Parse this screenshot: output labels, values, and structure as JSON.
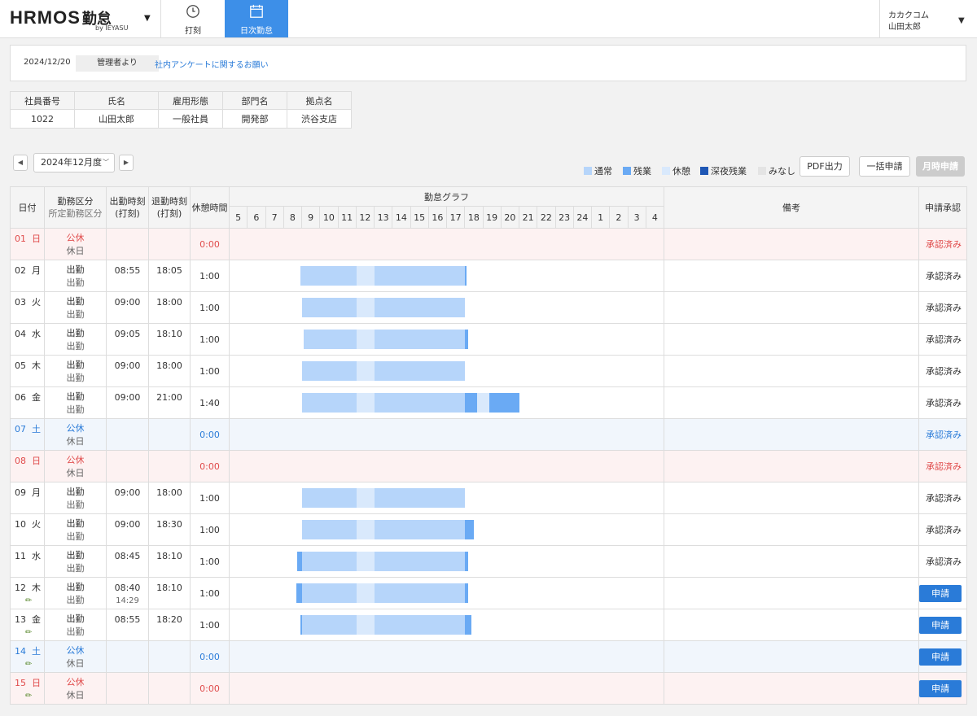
{
  "header": {
    "logo": "HRMOS",
    "logo_kin": "勤怠",
    "logo_sub": "by IEYASU",
    "tabs": [
      {
        "label": "打刻",
        "icon": "clock-icon"
      },
      {
        "label": "日次勤怠",
        "icon": "calendar-icon",
        "active": true
      }
    ],
    "user": {
      "company": "カカクコム",
      "name": "山田太郎"
    }
  },
  "notice": {
    "date": "2024/12/20",
    "from": "管理者より",
    "link": "社内アンケートに関するお願い"
  },
  "employee": {
    "headers": [
      "社員番号",
      "氏名",
      "雇用形態",
      "部門名",
      "拠点名"
    ],
    "values": [
      "1022",
      "山田太郎",
      "一般社員",
      "開発部",
      "渋谷支店"
    ]
  },
  "month": {
    "label": "2024年12月度"
  },
  "legend": [
    {
      "label": "通常",
      "color": "#b6d5fa"
    },
    {
      "label": "残業",
      "color": "#6aaaf4"
    },
    {
      "label": "休憩",
      "color": "#d9e9fc"
    },
    {
      "label": "深夜残業",
      "color": "#1f57b5"
    },
    {
      "label": "みなし",
      "color": "#e4e4e4"
    }
  ],
  "buttons": {
    "pdf": "PDF出力",
    "bulk": "一括申請",
    "monthly": "月時申請"
  },
  "table": {
    "headers": {
      "date": "日付",
      "kubun_main": "勤務区分",
      "kubun_sub": "所定勤務区分",
      "start": "出勤時刻",
      "start_sub": "(打刻)",
      "end": "退勤時刻",
      "end_sub": "(打刻)",
      "break": "休憩時間",
      "graph": "勤怠グラフ",
      "note": "備考",
      "approval": "申請承認"
    },
    "hours": [
      "5",
      "6",
      "7",
      "8",
      "9",
      "10",
      "11",
      "12",
      "13",
      "14",
      "15",
      "16",
      "17",
      "18",
      "19",
      "20",
      "21",
      "22",
      "23",
      "24",
      "1",
      "2",
      "3",
      "4"
    ],
    "rows": [
      {
        "day": "01",
        "wd": "日",
        "type": "sun",
        "kubun": "公休",
        "sub": "休日",
        "start": "",
        "end": "",
        "start2": "",
        "break": "0:00",
        "approval": "承認済み",
        "btn": false,
        "pen": false,
        "segs": []
      },
      {
        "day": "02",
        "wd": "月",
        "type": "",
        "kubun": "出勤",
        "sub": "出勤",
        "start": "08:55",
        "end": "18:05",
        "start2": "",
        "break": "1:00",
        "approval": "承認済み",
        "btn": false,
        "pen": false,
        "segs": [
          {
            "f": 8.917,
            "t": 12,
            "k": "n"
          },
          {
            "f": 12,
            "t": 13,
            "k": "b"
          },
          {
            "f": 13,
            "t": 18,
            "k": "n"
          },
          {
            "f": 18,
            "t": 18.083,
            "k": "o"
          }
        ]
      },
      {
        "day": "03",
        "wd": "火",
        "type": "",
        "kubun": "出勤",
        "sub": "出勤",
        "start": "09:00",
        "end": "18:00",
        "start2": "",
        "break": "1:00",
        "approval": "承認済み",
        "btn": false,
        "pen": false,
        "segs": [
          {
            "f": 9,
            "t": 12,
            "k": "n"
          },
          {
            "f": 12,
            "t": 13,
            "k": "b"
          },
          {
            "f": 13,
            "t": 18,
            "k": "n"
          }
        ]
      },
      {
        "day": "04",
        "wd": "水",
        "type": "",
        "kubun": "出勤",
        "sub": "出勤",
        "start": "09:05",
        "end": "18:10",
        "start2": "",
        "break": "1:00",
        "approval": "承認済み",
        "btn": false,
        "pen": false,
        "segs": [
          {
            "f": 9.083,
            "t": 12,
            "k": "n"
          },
          {
            "f": 12,
            "t": 13,
            "k": "b"
          },
          {
            "f": 13,
            "t": 18,
            "k": "n"
          },
          {
            "f": 18,
            "t": 18.167,
            "k": "o"
          }
        ]
      },
      {
        "day": "05",
        "wd": "木",
        "type": "",
        "kubun": "出勤",
        "sub": "出勤",
        "start": "09:00",
        "end": "18:00",
        "start2": "",
        "break": "1:00",
        "approval": "承認済み",
        "btn": false,
        "pen": false,
        "segs": [
          {
            "f": 9,
            "t": 12,
            "k": "n"
          },
          {
            "f": 12,
            "t": 13,
            "k": "b"
          },
          {
            "f": 13,
            "t": 18,
            "k": "n"
          }
        ]
      },
      {
        "day": "06",
        "wd": "金",
        "type": "",
        "kubun": "出勤",
        "sub": "出勤",
        "start": "09:00",
        "end": "21:00",
        "start2": "",
        "break": "1:40",
        "approval": "承認済み",
        "btn": false,
        "pen": false,
        "segs": [
          {
            "f": 9,
            "t": 12,
            "k": "n"
          },
          {
            "f": 12,
            "t": 13,
            "k": "b"
          },
          {
            "f": 13,
            "t": 18,
            "k": "n"
          },
          {
            "f": 18,
            "t": 18.667,
            "k": "o"
          },
          {
            "f": 18.667,
            "t": 19.333,
            "k": "b"
          },
          {
            "f": 19.333,
            "t": 21,
            "k": "o"
          }
        ]
      },
      {
        "day": "07",
        "wd": "土",
        "type": "sat",
        "kubun": "公休",
        "sub": "休日",
        "start": "",
        "end": "",
        "start2": "",
        "break": "0:00",
        "approval": "承認済み",
        "btn": false,
        "pen": false,
        "segs": []
      },
      {
        "day": "08",
        "wd": "日",
        "type": "sun",
        "kubun": "公休",
        "sub": "休日",
        "start": "",
        "end": "",
        "start2": "",
        "break": "0:00",
        "approval": "承認済み",
        "btn": false,
        "pen": false,
        "segs": []
      },
      {
        "day": "09",
        "wd": "月",
        "type": "",
        "kubun": "出勤",
        "sub": "出勤",
        "start": "09:00",
        "end": "18:00",
        "start2": "",
        "break": "1:00",
        "approval": "承認済み",
        "btn": false,
        "pen": false,
        "segs": [
          {
            "f": 9,
            "t": 12,
            "k": "n"
          },
          {
            "f": 12,
            "t": 13,
            "k": "b"
          },
          {
            "f": 13,
            "t": 18,
            "k": "n"
          }
        ]
      },
      {
        "day": "10",
        "wd": "火",
        "type": "",
        "kubun": "出勤",
        "sub": "出勤",
        "start": "09:00",
        "end": "18:30",
        "start2": "",
        "break": "1:00",
        "approval": "承認済み",
        "btn": false,
        "pen": false,
        "segs": [
          {
            "f": 9,
            "t": 12,
            "k": "n"
          },
          {
            "f": 12,
            "t": 13,
            "k": "b"
          },
          {
            "f": 13,
            "t": 18,
            "k": "n"
          },
          {
            "f": 18,
            "t": 18.5,
            "k": "o"
          }
        ]
      },
      {
        "day": "11",
        "wd": "水",
        "type": "",
        "kubun": "出勤",
        "sub": "出勤",
        "start": "08:45",
        "end": "18:10",
        "start2": "",
        "break": "1:00",
        "approval": "承認済み",
        "btn": false,
        "pen": false,
        "segs": [
          {
            "f": 8.75,
            "t": 9,
            "k": "o"
          },
          {
            "f": 9,
            "t": 12,
            "k": "n"
          },
          {
            "f": 12,
            "t": 13,
            "k": "b"
          },
          {
            "f": 13,
            "t": 18,
            "k": "n"
          },
          {
            "f": 18,
            "t": 18.167,
            "k": "o"
          }
        ]
      },
      {
        "day": "12",
        "wd": "木",
        "type": "",
        "kubun": "出勤",
        "sub": "出勤",
        "start": "08:40",
        "end": "18:10",
        "start2": "14:29",
        "break": "1:00",
        "approval": "申請",
        "btn": true,
        "pen": true,
        "segs": [
          {
            "f": 8.667,
            "t": 9,
            "k": "o"
          },
          {
            "f": 9,
            "t": 12,
            "k": "n"
          },
          {
            "f": 12,
            "t": 13,
            "k": "b"
          },
          {
            "f": 13,
            "t": 18,
            "k": "n"
          },
          {
            "f": 18,
            "t": 18.167,
            "k": "o"
          }
        ]
      },
      {
        "day": "13",
        "wd": "金",
        "type": "",
        "kubun": "出勤",
        "sub": "出勤",
        "start": "08:55",
        "end": "18:20",
        "start2": "",
        "break": "1:00",
        "approval": "申請",
        "btn": true,
        "pen": true,
        "segs": [
          {
            "f": 8.917,
            "t": 9,
            "k": "o"
          },
          {
            "f": 9,
            "t": 12,
            "k": "n"
          },
          {
            "f": 12,
            "t": 13,
            "k": "b"
          },
          {
            "f": 13,
            "t": 18,
            "k": "n"
          },
          {
            "f": 18,
            "t": 18.333,
            "k": "o"
          }
        ]
      },
      {
        "day": "14",
        "wd": "土",
        "type": "sat",
        "kubun": "公休",
        "sub": "休日",
        "start": "",
        "end": "",
        "start2": "",
        "break": "0:00",
        "approval": "申請",
        "btn": true,
        "pen": true,
        "segs": []
      },
      {
        "day": "15",
        "wd": "日",
        "type": "sun",
        "kubun": "公休",
        "sub": "休日",
        "start": "",
        "end": "",
        "start2": "",
        "break": "0:00",
        "approval": "申請",
        "btn": true,
        "pen": true,
        "segs": []
      }
    ]
  }
}
